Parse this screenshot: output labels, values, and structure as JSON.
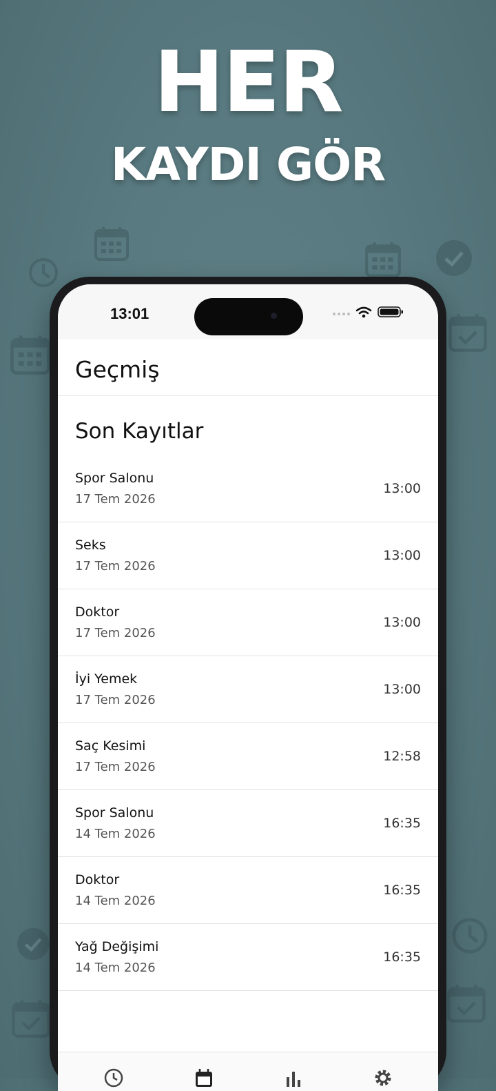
{
  "promo": {
    "headline_line1": "HER",
    "headline_line2": "KAYDI GÖR"
  },
  "status_bar": {
    "time": "13:01"
  },
  "nav": {
    "title": "Geçmiş"
  },
  "section": {
    "title": "Son Kayıtlar"
  },
  "records": [
    {
      "title": "Spor Salonu",
      "date": "17 Tem 2026",
      "time": "13:00"
    },
    {
      "title": "Seks",
      "date": "17 Tem 2026",
      "time": "13:00"
    },
    {
      "title": "Doktor",
      "date": "17 Tem 2026",
      "time": "13:00"
    },
    {
      "title": "İyi Yemek",
      "date": "17 Tem 2026",
      "time": "13:00"
    },
    {
      "title": "Saç Kesimi",
      "date": "17 Tem 2026",
      "time": "12:58"
    },
    {
      "title": "Spor Salonu",
      "date": "14 Tem 2026",
      "time": "16:35"
    },
    {
      "title": "Doktor",
      "date": "14 Tem 2026",
      "time": "16:35"
    },
    {
      "title": "Yağ Değişimi",
      "date": "14 Tem 2026",
      "time": "16:35"
    }
  ],
  "tabs": [
    {
      "icon": "clock-icon"
    },
    {
      "icon": "calendar-icon"
    },
    {
      "icon": "bar-chart-icon"
    },
    {
      "icon": "gear-icon"
    }
  ],
  "colors": {
    "background": "#587a80",
    "headline": "#ffffff",
    "phone_frame": "#1b1b1d",
    "screen": "#ffffff"
  }
}
